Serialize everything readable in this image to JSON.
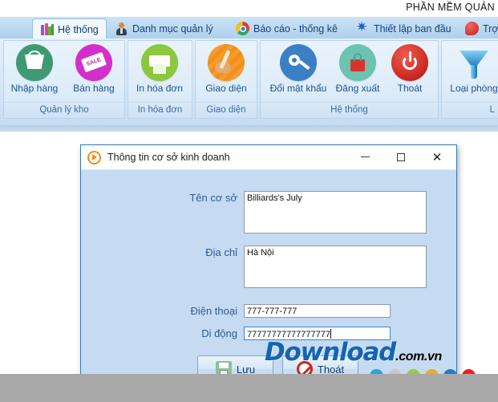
{
  "app": {
    "header_title": "PHẦN MỀM QUẢN",
    "tabs": [
      {
        "label": "Hệ thống",
        "icon": "books-icon",
        "active": true
      },
      {
        "label": "Danh mục quản lý",
        "icon": "person-icon",
        "active": false
      },
      {
        "label": "Báo cáo - thống kê",
        "icon": "globe-icon",
        "active": false
      },
      {
        "label": "Thiết lập ban đầu",
        "icon": "gear-icon",
        "active": false
      },
      {
        "label": "Trợ g",
        "icon": "help-icon",
        "active": false
      }
    ],
    "ribbon_groups": [
      {
        "label": "Quản lý kho",
        "buttons": [
          {
            "label": "Nhập hàng",
            "icon": "basket-icon"
          },
          {
            "label": "Bán hàng",
            "icon": "sale-tag-icon"
          }
        ]
      },
      {
        "label": "In hóa đơn",
        "buttons": [
          {
            "label": "In hóa đơn",
            "icon": "printer-icon"
          }
        ]
      },
      {
        "label": "Giao diện",
        "buttons": [
          {
            "label": "Giao diện",
            "icon": "paint-palette-icon"
          }
        ]
      },
      {
        "label": "Hệ thống",
        "buttons": [
          {
            "label": "Đổi mật khẩu",
            "icon": "key-icon"
          },
          {
            "label": "Đăng xuất",
            "icon": "lock-icon"
          },
          {
            "label": "Thoát",
            "icon": "power-icon"
          }
        ]
      },
      {
        "label": "L",
        "buttons": [
          {
            "label": "Loại phòng",
            "icon": "funnel-icon"
          }
        ]
      }
    ]
  },
  "dialog": {
    "title": "Thông tin cơ sở kinh doanh",
    "logo_icon": "orange-circle-play-icon",
    "window_controls": {
      "minimize": "minimize-icon",
      "maximize": "maximize-icon",
      "close": "close-icon"
    },
    "fields": [
      {
        "label": "Tên cơ sở",
        "value": "Billiards's July",
        "type": "textarea",
        "focused": false
      },
      {
        "label": "Địa chỉ",
        "value": "Hà Nội",
        "type": "textarea",
        "focused": false
      },
      {
        "label": "Điện thoại",
        "value": "777-777-777",
        "type": "text",
        "focused": false
      },
      {
        "label": "Di động",
        "value": "77777777777777777",
        "type": "text",
        "focused": true
      }
    ],
    "buttons": [
      {
        "label": "Lưu",
        "icon": "save-icon"
      },
      {
        "label": "Thoát",
        "icon": "no-entry-icon"
      }
    ]
  },
  "watermark": {
    "main": "Download",
    "suffix": ".com.vn",
    "dot_colors": [
      "#24a6e0",
      "#c9c9c9",
      "#95cc3c",
      "#f5a623",
      "#1f7dc4",
      "#ec2024"
    ]
  },
  "colors": {
    "accent": "#1464b4",
    "tab_active_bg": "#f3f8fd",
    "dialog_body_bg": "#c6daf1",
    "label_color": "#2e5c93"
  }
}
